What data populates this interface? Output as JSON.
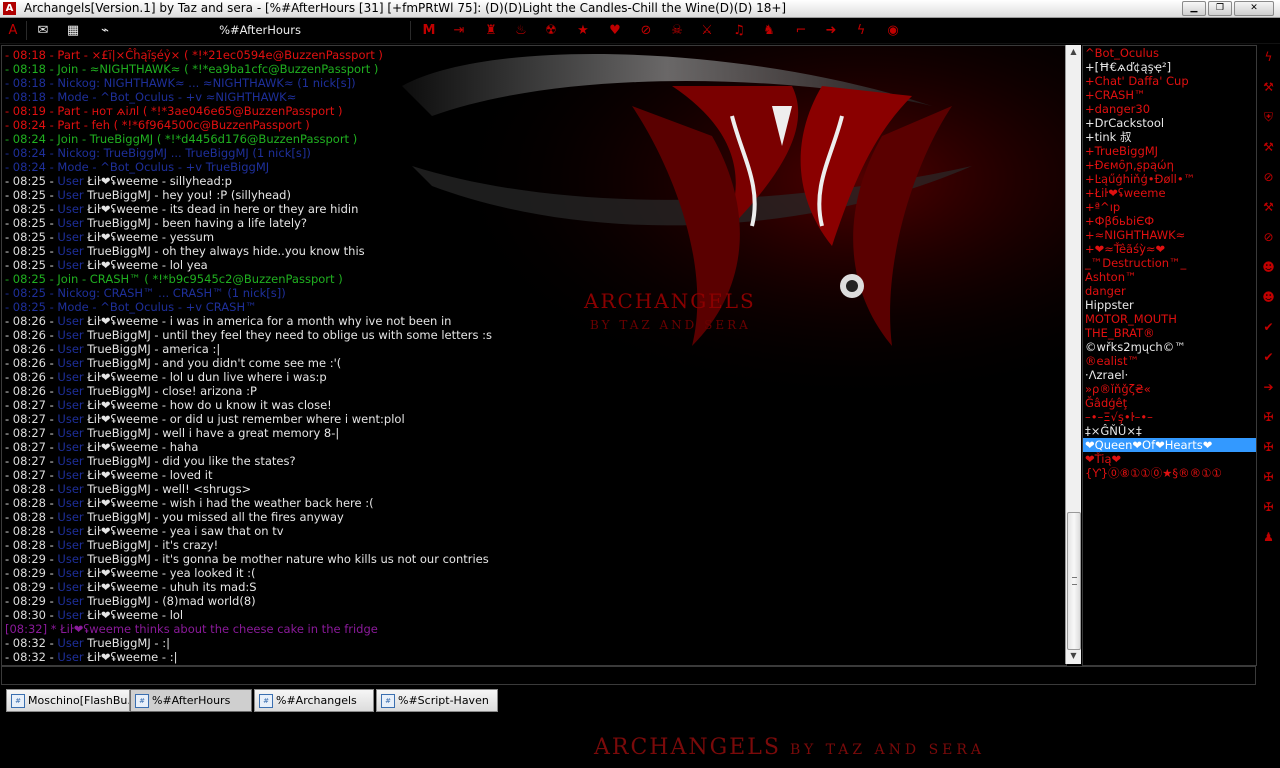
{
  "window": {
    "title": "Archangels[Version.1] by Taz and sera - [%#AfterHours [31] [+fmPRtWl 75]: (D)(D)Light the Candles-Chill the Wine(D)(D) 18+]",
    "app_icon": "A",
    "controls": [
      "minimize-icon",
      "restore-icon",
      "close-icon"
    ]
  },
  "toolbar": {
    "channel_tab": "%#AfterHours",
    "icons": [
      "archangels-logo-icon",
      "mail-icon",
      "image-icon",
      "chart-icon",
      "m-icon",
      "exit-icon",
      "hat-icon",
      "cup-icon",
      "radiation-icon",
      "star-icon",
      "heart-icon",
      "ban-icon",
      "skull-icon",
      "sword-icon",
      "music-icon",
      "horse-icon",
      "gun-icon",
      "arrow-icon",
      "bolt-icon",
      "record-icon"
    ]
  },
  "chat": {
    "background_text": "ARCHANGELS",
    "background_subtext": "BY TAZ AND SERA",
    "lines": [
      {
        "kind": "part",
        "text": "- 08:18 - Part - ×£ï|×Ĉĥąĩşéỷ× ( *!*21ec0594e@BuzzenPassport )"
      },
      {
        "kind": "join",
        "text": "- 08:18 - Join - ≈NIGHTHAWK≈ ( *!*ea9ba1cfc@BuzzenPassport )"
      },
      {
        "kind": "nick",
        "text": "- 08:18 - Nickog: NIGHTHAWK≈ ... ≈NIGHTHAWK≈ (1 nick[s])"
      },
      {
        "kind": "mode",
        "text": "- 08:18 - Mode - ^Bot_Oculus - +v ≈NIGHTHAWK≈"
      },
      {
        "kind": "part",
        "text": "- 08:19 - Part - нот ѧiлl ( *!*3ae046e65@BuzzenPassport )"
      },
      {
        "kind": "part",
        "text": "- 08:24 - Part - feh ( *!*6f964500c@BuzzenPassport )"
      },
      {
        "kind": "join",
        "text": "- 08:24 - Join - TrueBiggMJ ( *!*d4456d176@BuzzenPassport )"
      },
      {
        "kind": "nick",
        "text": "- 08:24 - Nickog: TrueBiggMJ ... TrueBiggMJ (1 nick[s])"
      },
      {
        "kind": "mode",
        "text": "- 08:24 - Mode - ^Bot_Oculus - +v TrueBiggMJ"
      },
      {
        "kind": "msg",
        "time": "- 08:25 -",
        "user": "User",
        "nick": "Łiŀ❤ʢweeme",
        "text": "- sillyhead:p"
      },
      {
        "kind": "msg",
        "time": "- 08:25 -",
        "user": "User",
        "nick": "TrueBiggMJ",
        "text": "- hey you! :P (sillyhead)"
      },
      {
        "kind": "msg",
        "time": "- 08:25 -",
        "user": "User",
        "nick": "Łiŀ❤ʢweeme",
        "text": "- its dead in here or they are hidin"
      },
      {
        "kind": "msg",
        "time": "- 08:25 -",
        "user": "User",
        "nick": "TrueBiggMJ",
        "text": "- been having a life lately?"
      },
      {
        "kind": "msg",
        "time": "- 08:25 -",
        "user": "User",
        "nick": "Łiŀ❤ʢweeme",
        "text": "- yessum"
      },
      {
        "kind": "msg",
        "time": "- 08:25 -",
        "user": "User",
        "nick": "TrueBiggMJ",
        "text": "- oh they always hide..you know this"
      },
      {
        "kind": "msg",
        "time": "- 08:25 -",
        "user": "User",
        "nick": "Łiŀ❤ʢweeme",
        "text": "- lol yea"
      },
      {
        "kind": "join",
        "text": "- 08:25 - Join - CRASH™ ( *!*b9c9545c2@BuzzenPassport )"
      },
      {
        "kind": "nick",
        "text": "- 08:25 - Nickog: CRASH™ ... CRASH™ (1 nick[s])"
      },
      {
        "kind": "mode",
        "text": "- 08:25 - Mode - ^Bot_Oculus - +v CRASH™"
      },
      {
        "kind": "msg",
        "time": "- 08:26 -",
        "user": "User",
        "nick": "Łiŀ❤ʢweeme",
        "text": "- i was in america for a month why ive not been in"
      },
      {
        "kind": "msg",
        "time": "- 08:26 -",
        "user": "User",
        "nick": "TrueBiggMJ",
        "text": "- until they feel they need to oblige us with some letters :s"
      },
      {
        "kind": "msg",
        "time": "- 08:26 -",
        "user": "User",
        "nick": "TrueBiggMJ",
        "text": "- america :|"
      },
      {
        "kind": "msg",
        "time": "- 08:26 -",
        "user": "User",
        "nick": "TrueBiggMJ",
        "text": "- and you didn't come see me :'("
      },
      {
        "kind": "msg",
        "time": "- 08:26 -",
        "user": "User",
        "nick": "Łiŀ❤ʢweeme",
        "text": "- lol u dun live where i was:p"
      },
      {
        "kind": "msg",
        "time": "- 08:26 -",
        "user": "User",
        "nick": "TrueBiggMJ",
        "text": "- close! arizona :P"
      },
      {
        "kind": "msg",
        "time": "- 08:27 -",
        "user": "User",
        "nick": "Łiŀ❤ʢweeme",
        "text": "- how do u know it was close!"
      },
      {
        "kind": "msg",
        "time": "- 08:27 -",
        "user": "User",
        "nick": "Łiŀ❤ʢweeme",
        "text": "- or did u just remember where i went:plol"
      },
      {
        "kind": "msg",
        "time": "- 08:27 -",
        "user": "User",
        "nick": "TrueBiggMJ",
        "text": "- well i have a great memory 8-|"
      },
      {
        "kind": "msg",
        "time": "- 08:27 -",
        "user": "User",
        "nick": "Łiŀ❤ʢweeme",
        "text": "- haha"
      },
      {
        "kind": "msg",
        "time": "- 08:27 -",
        "user": "User",
        "nick": "TrueBiggMJ",
        "text": "- did you like the states?"
      },
      {
        "kind": "msg",
        "time": "- 08:27 -",
        "user": "User",
        "nick": "Łiŀ❤ʢweeme",
        "text": "- loved it"
      },
      {
        "kind": "msg",
        "time": "- 08:28 -",
        "user": "User",
        "nick": "TrueBiggMJ",
        "text": "- well! <shrugs>"
      },
      {
        "kind": "msg",
        "time": "- 08:28 -",
        "user": "User",
        "nick": "Łiŀ❤ʢweeme",
        "text": "- wish i had the weather back here :("
      },
      {
        "kind": "msg",
        "time": "- 08:28 -",
        "user": "User",
        "nick": "TrueBiggMJ",
        "text": "- you missed all the fires anyway"
      },
      {
        "kind": "msg",
        "time": "- 08:28 -",
        "user": "User",
        "nick": "Łiŀ❤ʢweeme",
        "text": "- yea i saw that on tv"
      },
      {
        "kind": "msg",
        "time": "- 08:28 -",
        "user": "User",
        "nick": "TrueBiggMJ",
        "text": "- it's crazy!"
      },
      {
        "kind": "msg",
        "time": "- 08:29 -",
        "user": "User",
        "nick": "TrueBiggMJ",
        "text": "- it's gonna be mother nature who kills us not our contries"
      },
      {
        "kind": "msg",
        "time": "- 08:29 -",
        "user": "User",
        "nick": "Łiŀ❤ʢweeme",
        "text": "- yea looked it :("
      },
      {
        "kind": "msg",
        "time": "- 08:29 -",
        "user": "User",
        "nick": "Łiŀ❤ʢweeme",
        "text": "- uhuh its mad:S"
      },
      {
        "kind": "msg",
        "time": "- 08:29 -",
        "user": "User",
        "nick": "TrueBiggMJ",
        "text": "- (8)mad world(8)"
      },
      {
        "kind": "msg",
        "time": "- 08:30 -",
        "user": "User",
        "nick": "Łiŀ❤ʢweeme",
        "text": "- lol"
      },
      {
        "kind": "action",
        "text": "[08:32] * Łiŀ❤ʢweeme thinks about the cheese cake in the fridge"
      },
      {
        "kind": "msg",
        "time": "- 08:32 -",
        "user": "User",
        "nick": "TrueBiggMJ",
        "text": "- :|"
      },
      {
        "kind": "msg",
        "time": "- 08:32 -",
        "user": "User",
        "nick": "Łiŀ❤ʢweeme",
        "text": "- :|"
      }
    ]
  },
  "nicklist": {
    "selected_index": 28,
    "items": [
      {
        "name": "^Bot_Oculus",
        "color": "red"
      },
      {
        "name": "+[Ħ€ѧď¢ąşҿ²]",
        "color": "white"
      },
      {
        "name": "+Chat' Daffa' Cup",
        "color": "red"
      },
      {
        "name": "+CRASH™",
        "color": "red"
      },
      {
        "name": "+danger30",
        "color": "red"
      },
      {
        "name": "+DrCackstool",
        "color": "white"
      },
      {
        "name": "+tink 叔",
        "color": "white"
      },
      {
        "name": "+TrueBiggMJ",
        "color": "red"
      },
      {
        "name": "+Ðємȏɲ,ʂpąώη",
        "color": "red"
      },
      {
        "name": "+Ŀąűģhiňģ•Ðøll•™",
        "color": "red"
      },
      {
        "name": "+Łiŀ❤ʢweeme",
        "color": "red"
      },
      {
        "name": "+ª^ıp",
        "color": "red"
      },
      {
        "name": "+ФβбьbіЄФ",
        "color": "red"
      },
      {
        "name": "+≈NIGHTHAWK≈",
        "color": "red"
      },
      {
        "name": "+❤≈Ťêãśỳ≈❤",
        "color": "red"
      },
      {
        "name": "_™Destruction™_",
        "color": "red"
      },
      {
        "name": "Ashton™",
        "color": "red"
      },
      {
        "name": "danger",
        "color": "red"
      },
      {
        "name": "Hippster",
        "color": "white"
      },
      {
        "name": "MOTOR_MOUTH",
        "color": "red"
      },
      {
        "name": "THE_BRAT®",
        "color": "red"
      },
      {
        "name": "©wřks2ɱųch©™",
        "color": "white"
      },
      {
        "name": "®ealist™",
        "color": "red"
      },
      {
        "name": "·Λzrael·",
        "color": "white"
      },
      {
        "name": "»ρ®ǐňǧζ₴«",
        "color": "red"
      },
      {
        "name": "Ğâdģêţ",
        "color": "red"
      },
      {
        "name": "–•–Ξ√ş•ŀ–•–",
        "color": "red"
      },
      {
        "name": "‡×ĜŇÛ×‡",
        "color": "white"
      },
      {
        "name": "❤Queen❤Of❤Hearts❤",
        "color": "white"
      },
      {
        "name": "❤Ťią❤",
        "color": "red"
      },
      {
        "name": "{Ƴ}⓪⑧①①⓪★§®®①①",
        "color": "red"
      }
    ]
  },
  "sidebar_icons": [
    "lightning-icon",
    "hammer-icon",
    "shield-icon",
    "hammer-icon",
    "ban-icon",
    "hammer-icon",
    "ban-icon",
    "face-icon",
    "face-icon",
    "check-icon",
    "check-icon",
    "arrow-icon",
    "cross-icon",
    "cross-icon",
    "cross-icon",
    "cross-icon",
    "bell-icon"
  ],
  "switchbar": {
    "active_index": 1,
    "items": [
      {
        "label": "Moschino[FlashBu...",
        "icon": "status-icon"
      },
      {
        "label": "%#AfterHours",
        "icon": "channel-icon"
      },
      {
        "label": "%#Archangels",
        "icon": "channel-icon"
      },
      {
        "label": "%#Script-Haven",
        "icon": "channel-icon"
      }
    ]
  },
  "footer": {
    "logo_text": "ARCHANGELS",
    "logo_sub": "BY TAZ AND SERA"
  },
  "colors": {
    "part": "#e01010",
    "join": "#20b020",
    "user": "#1e2f9a",
    "action": "#8a1a9a",
    "accent": "#c00000",
    "selection": "#3399ff"
  }
}
